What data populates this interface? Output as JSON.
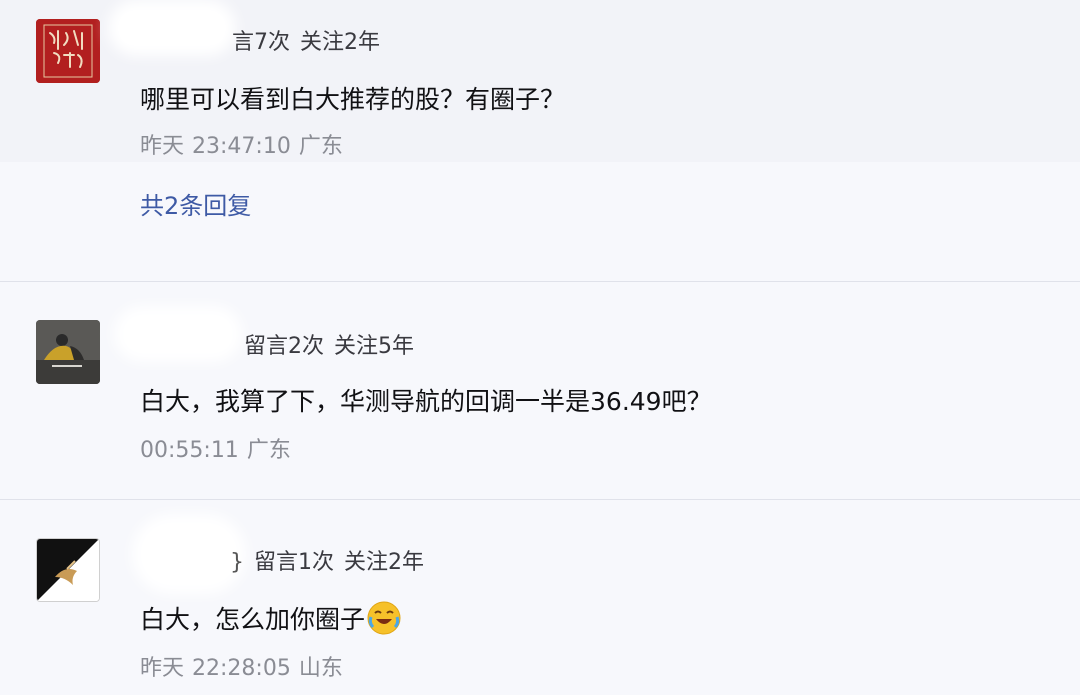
{
  "comments": [
    {
      "name_tail": "",
      "messages_count": "言7次",
      "follow_years": "关注2年",
      "text": "哪里可以看到白大推荐的股？有圈子？",
      "day": "昨天",
      "time": "23:47:10",
      "location": "广东",
      "replies_label": "共2条回复",
      "avatar_icon": "calligraphy-seal-icon"
    },
    {
      "name_tail": "",
      "messages_count": "留言2次",
      "follow_years": "关注5年",
      "text": "白大，我算了下，华测导航的回调一半是36.49吧？",
      "day": "",
      "time": "00:55:11",
      "location": "广东",
      "avatar_icon": "figure-photo-icon"
    },
    {
      "name_tail": "}",
      "messages_count": "留言1次",
      "follow_years": "关注2年",
      "text": "白大，怎么加你圈子",
      "day": "昨天",
      "time": "22:28:05",
      "location": "山东",
      "emoji_icon": "laughing-crying-emoji-icon",
      "avatar_icon": "black-white-diagonal-icon"
    }
  ],
  "colors": {
    "link": "#3e5aa5",
    "meta": "#8a8c94",
    "background": "#f7f8fc",
    "seal_red": "#b21f1f"
  }
}
